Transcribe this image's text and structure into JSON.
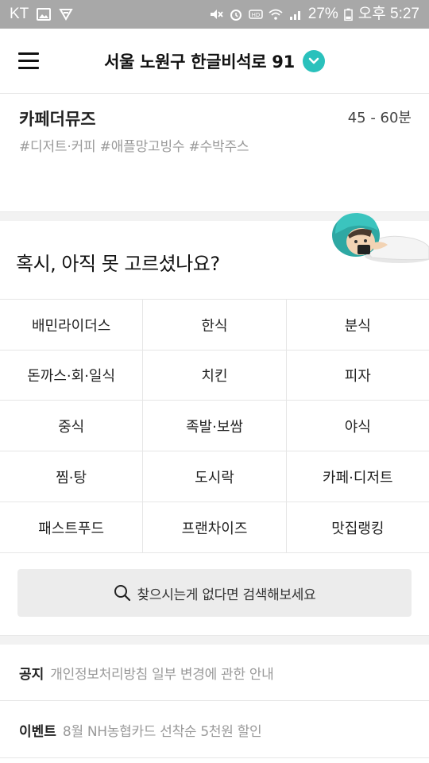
{
  "status_bar": {
    "carrier": "KT",
    "battery": "27%",
    "time": "오후 5:27"
  },
  "header": {
    "address": "서울 노원구 한글비석로 91",
    "accent_color": "#2ac1bc"
  },
  "restaurant": {
    "name": "카페더뮤즈",
    "delivery_time": "45 - 60분",
    "tags": "#디저트·커피 #애플망고빙수 #수박주스"
  },
  "question": {
    "text": "혹시, 아직 못 고르셨나요?"
  },
  "categories": [
    [
      "배민라이더스",
      "한식",
      "분식"
    ],
    [
      "돈까스·회·일식",
      "치킨",
      "피자"
    ],
    [
      "중식",
      "족발·보쌈",
      "야식"
    ],
    [
      "찜·탕",
      "도시락",
      "카페·디저트"
    ],
    [
      "패스트푸드",
      "프랜차이즈",
      "맛집랭킹"
    ]
  ],
  "search": {
    "label": "찾으시는게 없다면 검색해보세요",
    "icon": "search-icon"
  },
  "notices": [
    {
      "tag": "공지",
      "text": "개인정보처리방침 일부 변경에 관한 안내"
    },
    {
      "tag": "이벤트",
      "text": "8월 NH농협카드 선착순 5천원 할인"
    }
  ]
}
